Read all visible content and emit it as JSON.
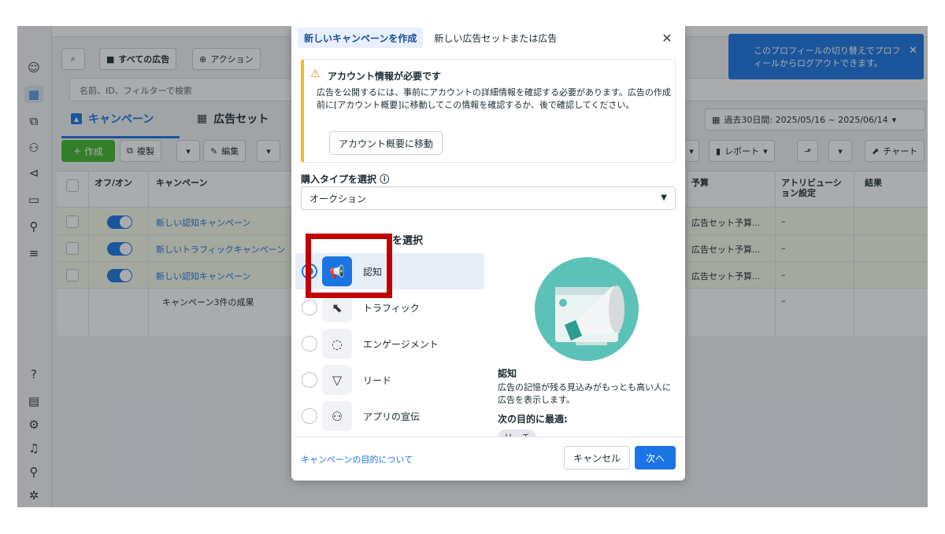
{
  "colors": {
    "accent": "#1b74e4",
    "warning": "#f7b928",
    "highlight": "#c00000",
    "create": "#42b72a"
  },
  "background": {
    "toolbar": {
      "search_icon": "search-icon",
      "all_ads": "すべての広告",
      "action": "アクション"
    },
    "search_placeholder": "名前、ID、フィルターで検索",
    "tabs": {
      "campaign": "キャンペーン",
      "adset": "広告セット"
    },
    "date_range": "過去30日間: 2025/05/16 ~ 2025/06/14",
    "actions": {
      "create": "作成",
      "duplicate": "複製",
      "edit": "編集",
      "report": "レポート",
      "chart": "チャート"
    },
    "table": {
      "headers": {
        "onoff": "オフ/オン",
        "campaign": "キャンペーン",
        "budget": "予算",
        "attribution": "アトリビューション設定",
        "results": "結果"
      },
      "rows": [
        {
          "name": "新しい認知キャンペーン",
          "budget": "広告セット予算...",
          "attribution": "–"
        },
        {
          "name": "新しいトラフィックキャンペーン",
          "budget": "広告セット予算...",
          "attribution": "–"
        },
        {
          "name": "新しい認知キャンペーン",
          "budget": "広告セット予算...",
          "attribution": "–"
        }
      ],
      "summary": {
        "label": "キャンペーン3件の成果",
        "attribution": "–"
      }
    },
    "tooltip": "このプロフィールの切り替えでプロフィールからログアウトできます。"
  },
  "modal": {
    "tabs": [
      "新しいキャンペーンを作成",
      "新しい広告セットまたは広告"
    ],
    "warning": {
      "title": "アカウント情報が必要です",
      "body": "広告を公開するには、事前にアカウントの詳細情報を確認する必要があります。広告の作成前に[アカウント概要]に移動してこの情報を確認するか、後で確認してください。",
      "button": "アカウント概要に移動"
    },
    "buy_type": {
      "label": "購入タイプを選択",
      "value": "オークション"
    },
    "objective_label": "を選択",
    "objectives": [
      {
        "label": "認知",
        "icon": "megaphone-icon",
        "selected": true
      },
      {
        "label": "トラフィック",
        "icon": "cursor-icon",
        "selected": false
      },
      {
        "label": "エンゲージメント",
        "icon": "chat-bubble-icon",
        "selected": false
      },
      {
        "label": "リード",
        "icon": "funnel-icon",
        "selected": false
      },
      {
        "label": "アプリの宣伝",
        "icon": "people-icon",
        "selected": false
      }
    ],
    "description": {
      "title": "認知",
      "body": "広告の記憶が残る見込みがもっとも高い人に広告を表示します。",
      "best_for_label": "次の目的に最適:",
      "chip": "リーチ"
    },
    "footer": {
      "link": "キャンペーンの目的について",
      "cancel": "キャンセル",
      "next": "次へ"
    }
  }
}
